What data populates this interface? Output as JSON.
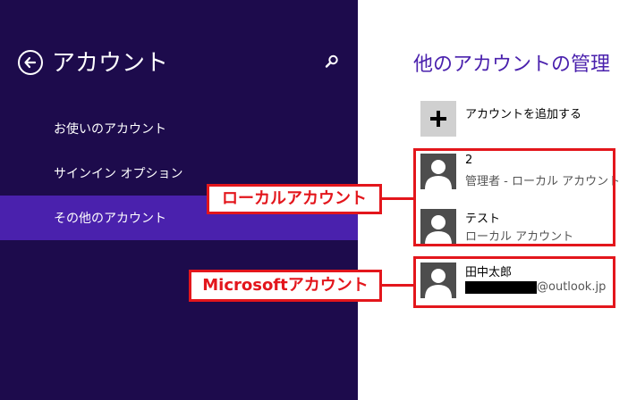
{
  "left_pane": {
    "title": "アカウント",
    "nav_items": [
      {
        "label": "お使いのアカウント",
        "selected": false
      },
      {
        "label": "サインイン オプション",
        "selected": false
      },
      {
        "label": "その他のアカウント",
        "selected": true
      }
    ],
    "colors": {
      "background": "#1d0b4c",
      "selected": "#4a21ad"
    }
  },
  "right_pane": {
    "title": "他のアカウントの管理",
    "add_account_label": "アカウントを追加する",
    "accounts": [
      {
        "name": "2",
        "type": "管理者 - ローカル アカウント"
      },
      {
        "name": "テスト",
        "type": "ローカル アカウント"
      },
      {
        "name": "田中太郎",
        "email_domain": "@outlook.jp"
      }
    ]
  },
  "annotations": {
    "local_label": "ローカルアカウント",
    "microsoft_label": "Microsoftアカウント",
    "color": "#e3161c"
  },
  "icons": [
    "back-arrow-icon",
    "search-icon",
    "plus-icon",
    "user-avatar-icon"
  ]
}
